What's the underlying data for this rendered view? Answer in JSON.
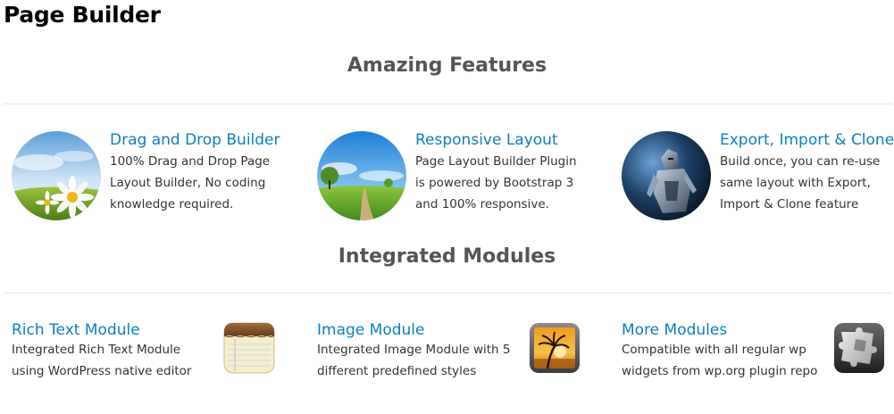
{
  "page": {
    "title": "Page Builder"
  },
  "features": {
    "heading": "Amazing Features",
    "items": [
      {
        "title": "Drag and Drop Builder",
        "text": "100% Drag and Drop Page Layout Builder, No coding knowledge required.",
        "image": "daisy-sky-image"
      },
      {
        "title": "Responsive Layout",
        "text": "Page Layout Builder Plugin is powered by Bootstrap 3 and 100% responsive.",
        "image": "green-field-path-image"
      },
      {
        "title": "Export, Import & Clone",
        "text": "Build once, you can re-use same layout with Export, Import & Clone feature",
        "image": "armored-knight-image"
      }
    ]
  },
  "modules": {
    "heading": "Integrated Modules",
    "items": [
      {
        "title": "Rich Text Module",
        "text": "Integrated Rich Text Module using WordPress native editor",
        "icon": "notepad-icon"
      },
      {
        "title": "Image Module",
        "text": "Integrated Image Module with 5 different predefined styles",
        "icon": "photo-palm-sunset-icon"
      },
      {
        "title": "More Modules",
        "text": "Compatible with all regular wp widgets from wp.org plugin repo",
        "icon": "puzzle-pieces-icon"
      }
    ]
  },
  "colors": {
    "link": "#0b7fc1",
    "heading": "#555555",
    "body_text": "#333333",
    "title": "#000000",
    "divider": "#e6e6e6"
  }
}
